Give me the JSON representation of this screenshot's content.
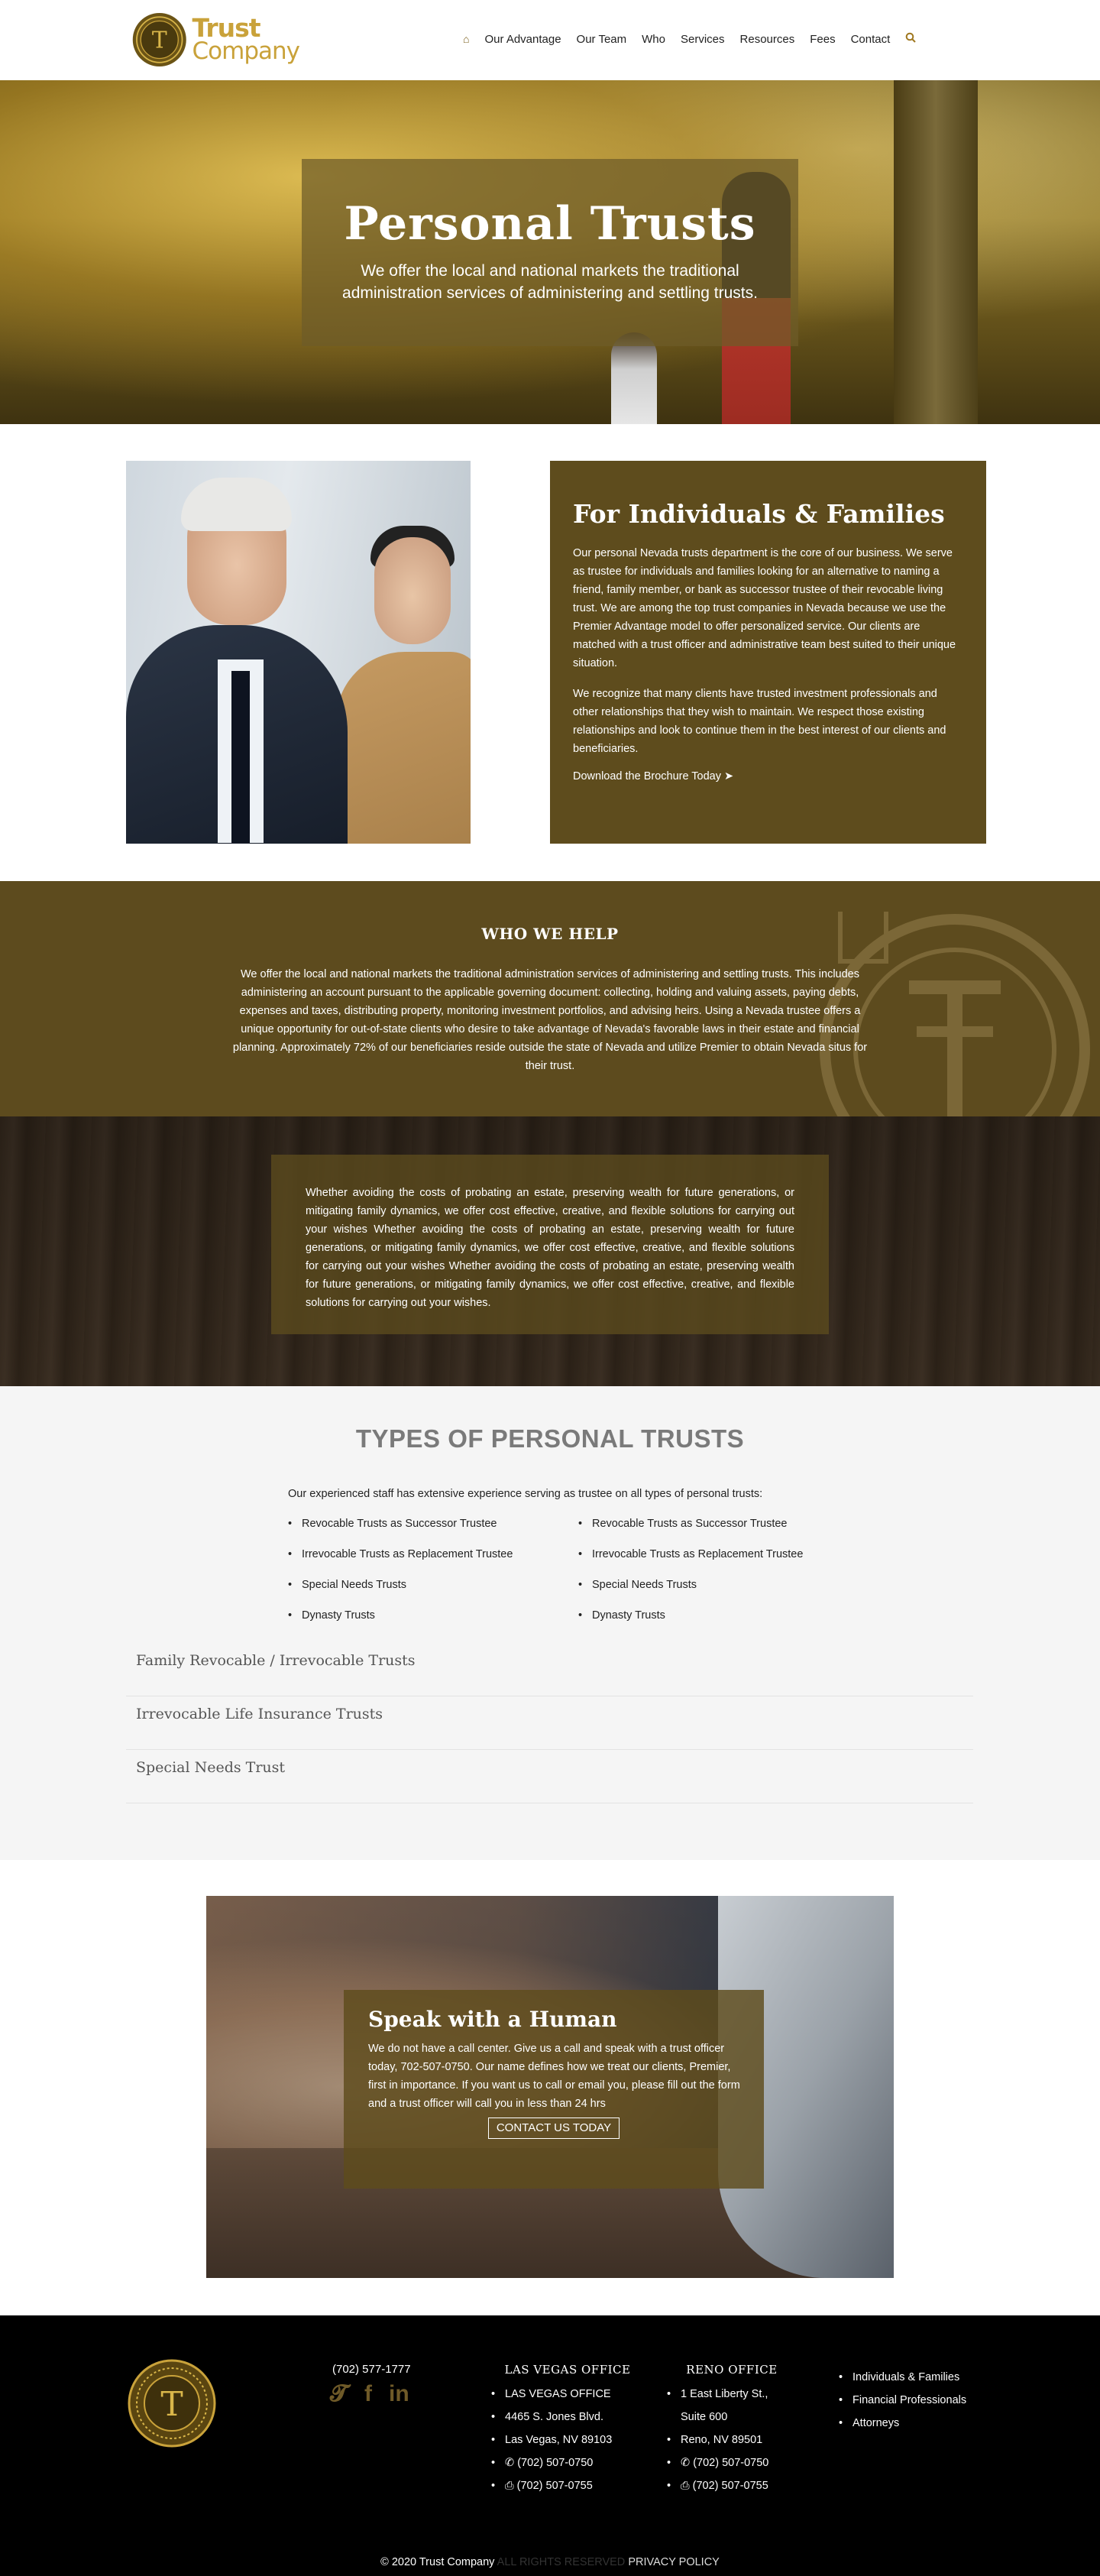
{
  "brand": {
    "name_line1": "Trust",
    "name_line2": "Company"
  },
  "nav": {
    "home_icon": "home-icon",
    "items": [
      "Our Advantage",
      "Our Team",
      "Who",
      "Services",
      "Resources",
      "Fees",
      "Contact"
    ],
    "search_icon": "search-icon"
  },
  "hero": {
    "title": "Personal Trusts",
    "subtitle": "We offer the local and national markets the traditional administration services of administering and settling trusts."
  },
  "individuals": {
    "title": "For Individuals & Families",
    "paragraph1": "Our personal Nevada trusts department is the core of our business. We serve as trustee for individuals and families looking for an alternative to naming a friend, family member, or bank as successor trustee of their revocable living trust. We are among the top trust companies in Nevada because we use the Premier Advantage model to offer personalized service. Our clients are matched with a trust officer and administrative team best suited to their unique situation.",
    "paragraph2": "We recognize that many clients have trusted investment professionals and other relationships that they wish to maintain. We respect those existing relationships and look to continue them in the best interest of our clients and beneficiaries.",
    "download_label": "Download the Brochure Today",
    "download_icon": "arrow-right-icon"
  },
  "who": {
    "title": "WHO WE HELP",
    "text": "We offer the local and national markets the traditional administration services of administering and settling trusts. This includes administering an account pursuant to the applicable governing document: collecting, holding and valuing assets, paying debts, expenses and taxes, distributing property, monitoring investment portfolios, and advising heirs. Using a Nevada trustee offers a unique opportunity for out-of-state clients who desire to take advantage of Nevada's favorable laws in their estate and financial planning. Approximately 72% of our beneficiaries reside outside the state of Nevada and utilize Premier to obtain Nevada situs for their trust."
  },
  "wood": {
    "text": "Whether avoiding the costs of probating an estate, preserving wealth for future generations, or mitigating family dynamics, we offer cost effective, creative, and flexible solutions for carrying out your wishes Whether avoiding the costs of probating an estate, preserving wealth for future generations, or mitigating family dynamics, we offer cost effective, creative, and flexible solutions for carrying out your wishes Whether avoiding the costs of probating an estate, preserving wealth for future generations, or mitigating family dynamics, we offer cost effective, creative, and flexible solutions for carrying out your wishes."
  },
  "types": {
    "title": "TYPES OF PERSONAL TRUSTS",
    "intro": "Our experienced staff has extensive experience serving as trustee on all types of personal trusts:",
    "list_left": [
      "Revocable Trusts as Successor Trustee",
      "Irrevocable Trusts as Replacement Trustee",
      "Special Needs Trusts",
      "Dynasty Trusts"
    ],
    "list_right": [
      "Revocable Trusts as Successor Trustee",
      "Irrevocable Trusts as Replacement Trustee",
      "Special Needs Trusts",
      "Dynasty Trusts"
    ],
    "accordion": [
      "Family Revocable / Irrevocable Trusts",
      "Irrevocable Life Insurance Trusts",
      "Special Needs Trust"
    ]
  },
  "speak": {
    "title": "Speak with a Human",
    "text": "We do not have a call center. Give us a call and speak with a trust officer today, 702-507-0750. Our name defines how we treat our clients, Premier, first in importance. If you want us to call or email you, please fill out the form and a trust officer will call you in less than 24 hrs",
    "cta": "CONTACT US TODAY"
  },
  "footer": {
    "phone": "(702) 577-1777",
    "social": [
      "twitter-icon",
      "facebook-icon",
      "linkedin-icon"
    ],
    "lv": {
      "title": "LAS VEGAS OFFICE",
      "lines": [
        "LAS VEGAS OFFICE",
        "4465 S. Jones Blvd.",
        "Las Vegas, NV 89103",
        "(702) 507-0750",
        "(702) 507-0755"
      ]
    },
    "reno": {
      "title": "RENO OFFICE",
      "lines": [
        "1 East Liberty St.,",
        "Suite 600",
        "Reno, NV 89501",
        "(702) 507-0750",
        "(702) 507-0755"
      ]
    },
    "links": [
      "Individuals & Families",
      "Financial Professionals",
      "Attorneys"
    ],
    "copyright": "© 2020 Trust Company",
    "rights": "ALL RIGHTS RESERVED",
    "privacy": "PRIVACY POLICY"
  }
}
